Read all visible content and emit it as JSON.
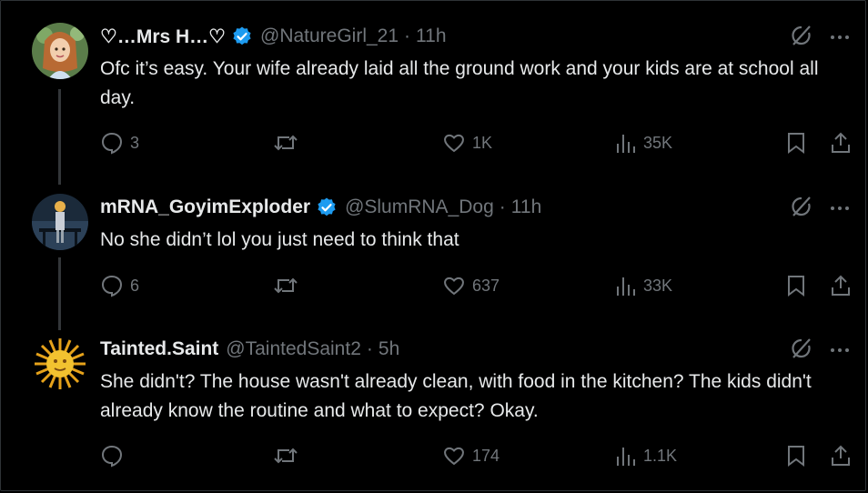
{
  "tweets": [
    {
      "name": "♡…Mrs H…♡",
      "handle": "@NatureGirl_21",
      "time": "11h",
      "text": "Ofc it’s easy. Your wife already laid all the ground work and your kids are at school all day.",
      "replies": "3",
      "retweets": "",
      "likes": "1K",
      "views": "35K",
      "verified": true
    },
    {
      "name": "mRNA_GoyimExploder",
      "handle": "@SlumRNA_Dog",
      "time": "11h",
      "text": "No she didn’t lol you just need to think that",
      "replies": "6",
      "retweets": "",
      "likes": "637",
      "views": "33K",
      "verified": true
    },
    {
      "name": "Tainted.Saint",
      "handle": "@TaintedSaint2",
      "time": "5h",
      "text": "She didn't? The house wasn't already clean, with food in the kitchen? The kids didn't already know the routine and what to expect? Okay.",
      "replies": "",
      "retweets": "",
      "likes": "174",
      "views": "1.1K",
      "verified": false
    }
  ],
  "separator": "·",
  "colors": {
    "background": "#000000",
    "text": "#e7e9ea",
    "muted": "#71767b",
    "verified": "#1d9bf0"
  }
}
